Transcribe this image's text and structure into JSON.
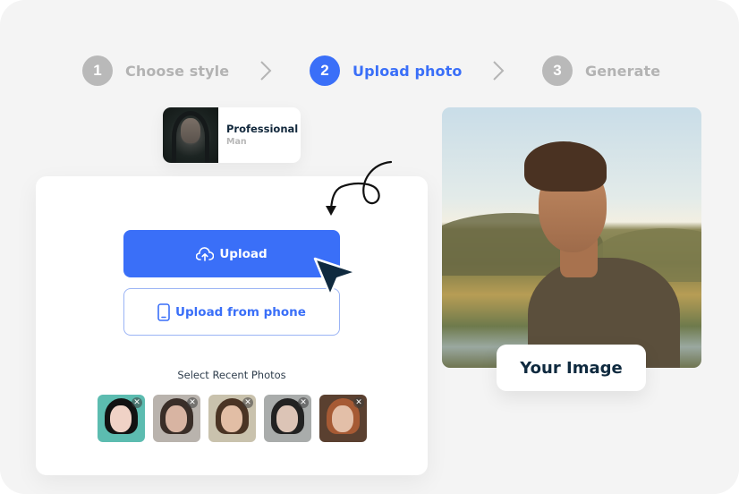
{
  "colors": {
    "accent": "#3a6ff8",
    "inactive": "#b9b9b9",
    "dark": "#0f2a3f",
    "background": "#f4f4f4"
  },
  "stepper": {
    "steps": [
      {
        "number": "1",
        "label": "Choose style",
        "state": "inactive"
      },
      {
        "number": "2",
        "label": "Upload photo",
        "state": "active"
      },
      {
        "number": "3",
        "label": "Generate",
        "state": "inactive"
      }
    ],
    "separator_icon": "chevron-right-icon"
  },
  "style_card": {
    "title": "Professional",
    "subtitle": "Man"
  },
  "upload": {
    "upload_label": "Upload",
    "upload_icon": "cloud-upload-icon",
    "phone_label": "Upload from phone",
    "phone_icon": "smartphone-icon"
  },
  "recent": {
    "label": "Select Recent Photos",
    "close_glyph": "✕",
    "photos": [
      {
        "name": "recent-photo-1"
      },
      {
        "name": "recent-photo-2"
      },
      {
        "name": "recent-photo-3"
      },
      {
        "name": "recent-photo-4"
      },
      {
        "name": "recent-photo-5"
      }
    ]
  },
  "preview": {
    "badge_label": "Your Image"
  }
}
